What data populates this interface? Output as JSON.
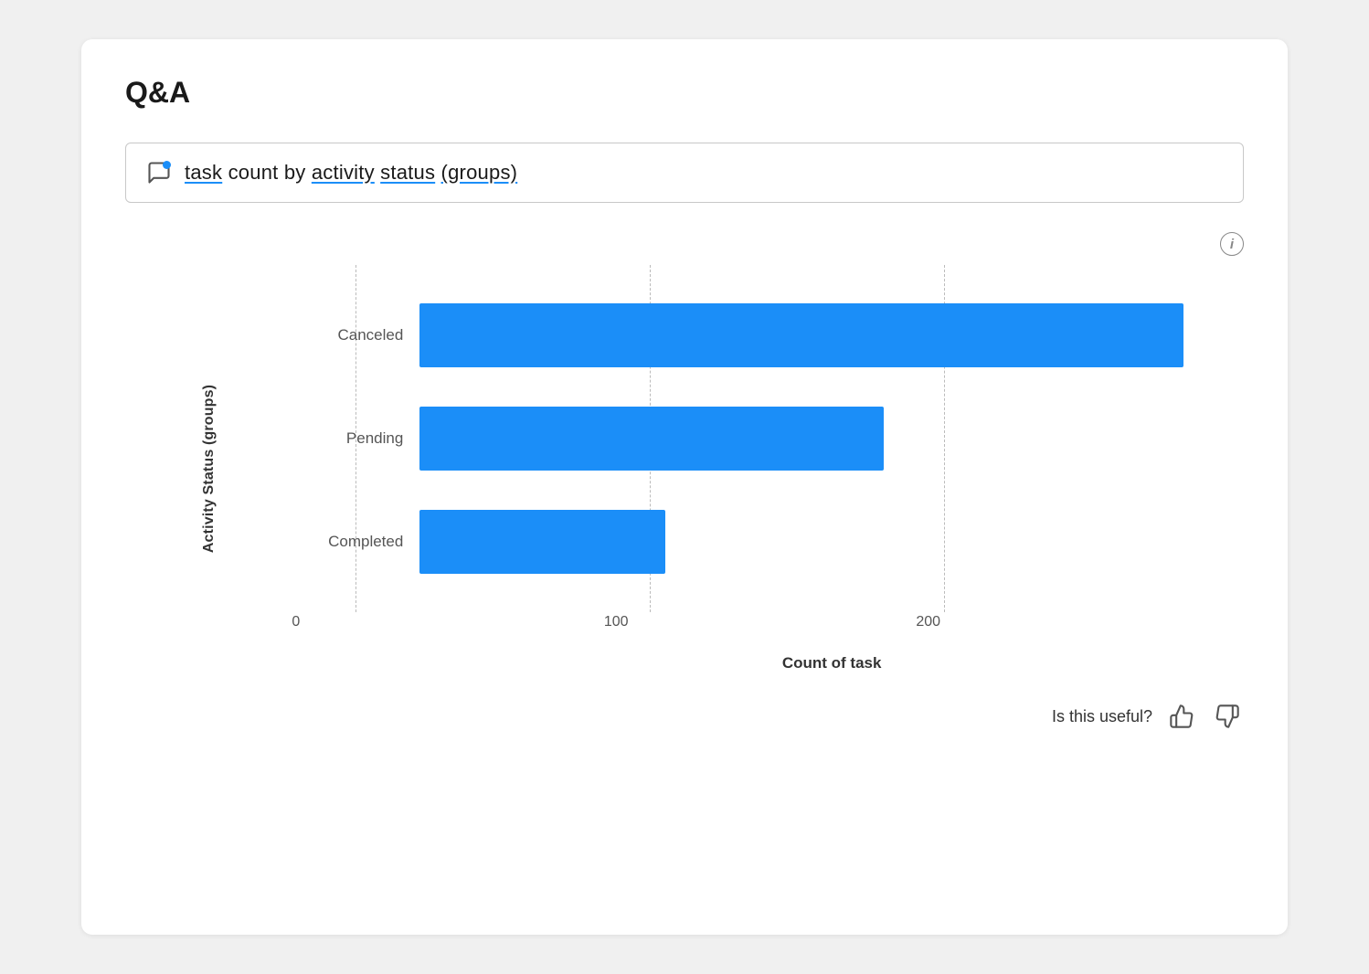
{
  "page": {
    "title": "Q&A",
    "query": {
      "text": "task count by activity status (groups)",
      "underline_words": [
        "task",
        "activity",
        "status",
        "(groups)"
      ]
    },
    "chart": {
      "y_axis_label": "Activity Status (groups)",
      "x_axis_label": "Count of task",
      "x_ticks": [
        "0",
        "100",
        "200"
      ],
      "bars": [
        {
          "label": "Canceled",
          "value": 280,
          "max": 290
        },
        {
          "label": "Pending",
          "value": 170,
          "max": 290
        },
        {
          "label": "Completed",
          "value": 90,
          "max": 290
        }
      ],
      "bar_color": "#1b8ef8"
    },
    "feedback": {
      "label": "Is this useful?",
      "thumbs_up": "👍",
      "thumbs_down": "👎"
    }
  }
}
